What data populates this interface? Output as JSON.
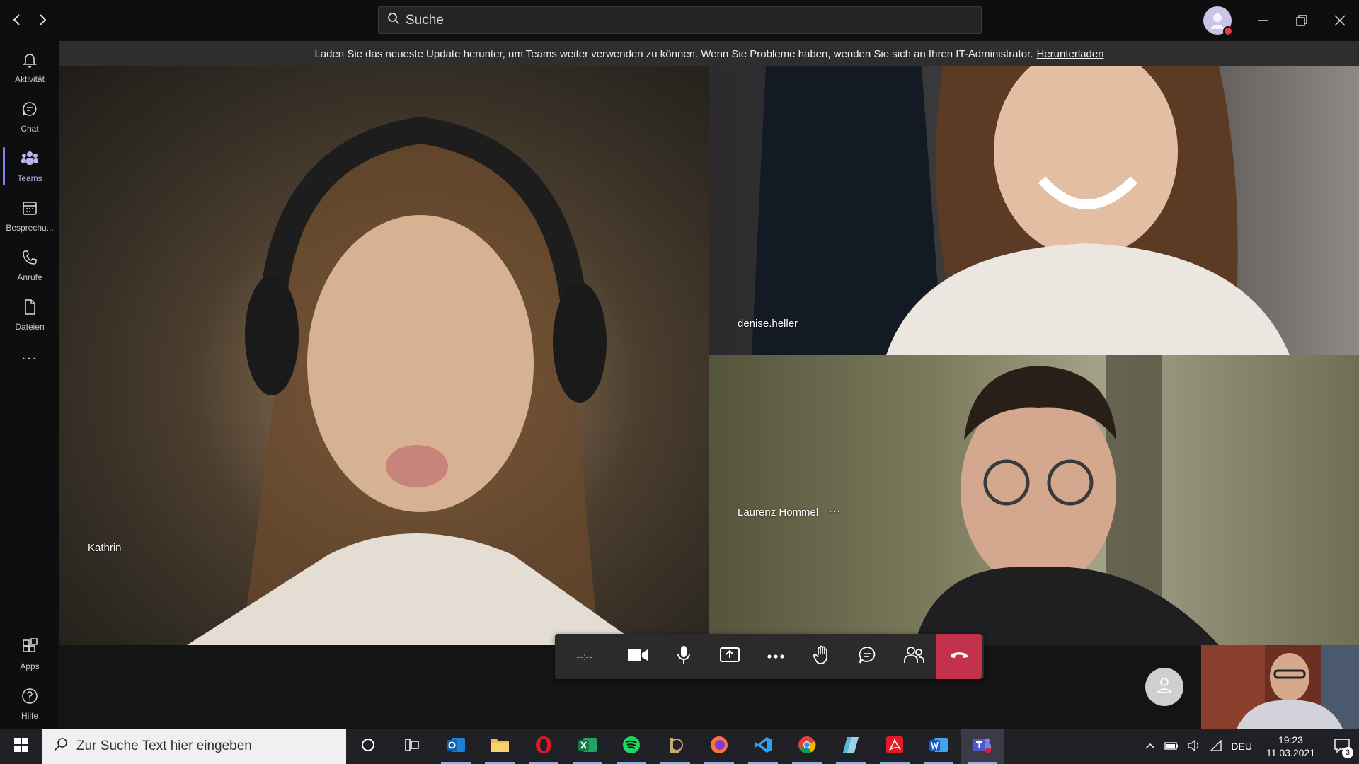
{
  "titlebar": {
    "search_placeholder": "Suche"
  },
  "rail": {
    "items": [
      {
        "label": "Aktivität",
        "icon": "bell-icon"
      },
      {
        "label": "Chat",
        "icon": "chat-icon"
      },
      {
        "label": "Teams",
        "icon": "teams-icon",
        "active": true
      },
      {
        "label": "Besprechu...",
        "icon": "calendar-icon"
      },
      {
        "label": "Anrufe",
        "icon": "phone-icon"
      },
      {
        "label": "Dateien",
        "icon": "file-icon"
      }
    ],
    "more": "...",
    "apps_label": "Apps",
    "help_label": "Hilfe"
  },
  "banner": {
    "text": "Laden Sie das neueste Update herunter, um Teams weiter verwenden zu können. Wenn Sie Probleme haben, wenden Sie sich an Ihren IT-Administrator.",
    "link": "Herunterladen"
  },
  "participants": [
    {
      "name": "Kathrin"
    },
    {
      "name": "denise.heller"
    },
    {
      "name": "Laurenz Hommel",
      "more": "···"
    }
  ],
  "callbar": {
    "timer": "--:--"
  },
  "taskbar": {
    "search_placeholder": "Zur Suche Text hier eingeben",
    "language": "DEU",
    "time": "19:23",
    "date": "11.03.2021",
    "notification_count": "3"
  },
  "colors": {
    "accent": "#7f85f5",
    "hangup": "#c4314b",
    "banner_bg": "#2e2e2e"
  }
}
